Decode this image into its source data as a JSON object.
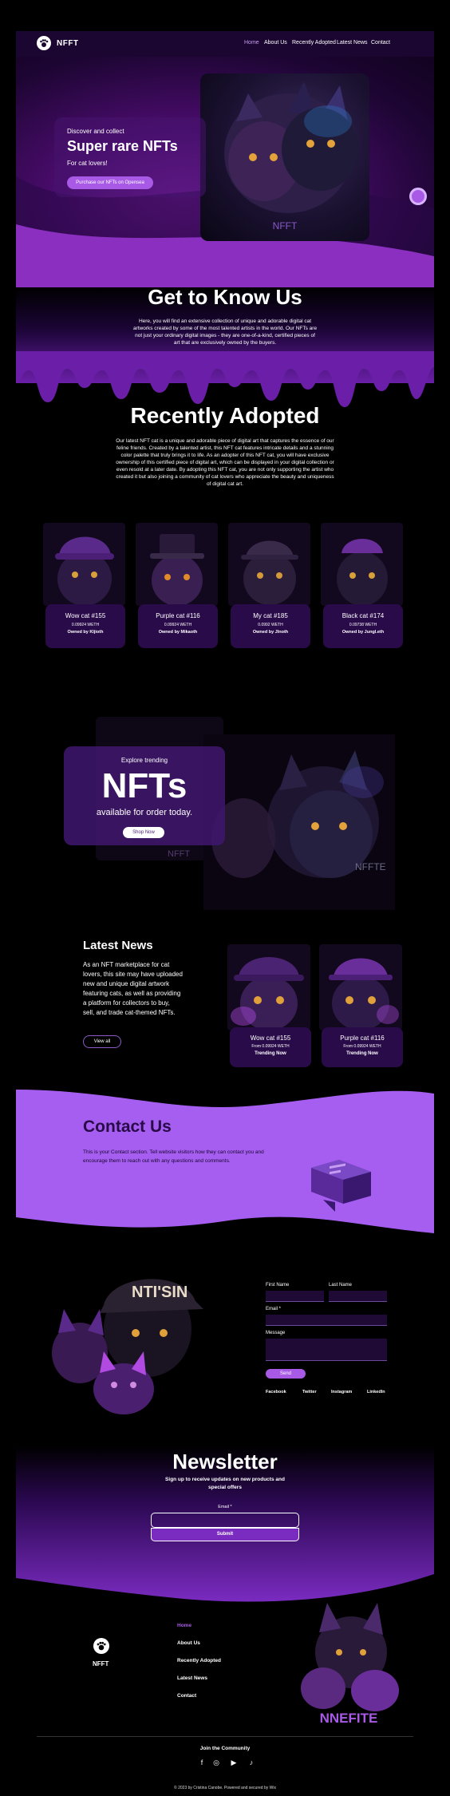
{
  "header": {
    "logo_text": "NFFT",
    "nav": [
      "Home",
      "About Us",
      "Recently Adopted",
      "Latest News",
      "Contact"
    ]
  },
  "hero": {
    "subtitle": "Discover and collect",
    "title": "Super rare NFTs",
    "small": "For cat lovers!",
    "button": "Purchase our NFTs on Opensea",
    "image_watermark": "NFFT"
  },
  "about": {
    "title": "Get to Know Us",
    "text": "Here, you will find an extensive collection of unique and adorable digital cat artworks created by some of the most talented artists in the world. Our NFTs are not just your ordinary digital images - they are one-of-a-kind, certified pieces of art that are exclusively owned by the buyers."
  },
  "recently_adopted": {
    "title": "Recently Adopted",
    "text": "Our latest NFT cat is a unique and adorable piece of digital art that captures the essence of our feline friends. Created by a talented artist, this NFT cat features intricate details and a stunning color palette that truly brings it to life. As an adopter of this NFT cat, you will have exclusive ownership of this certified piece of digital art, which can be displayed in your digital collection or even resold at a later date. By adopting this NFT cat, you are not only supporting the artist who created it but also joining a community of cat lovers who appreciate the beauty and uniqueness of digital cat art.",
    "cards": [
      {
        "name": "Wow cat #155",
        "price": "0.09924 WETH",
        "owner": "Owned by Kljioth"
      },
      {
        "name": "Purple cat #116",
        "price": "0.09924 WETH",
        "owner": "Owned by Mikaoth"
      },
      {
        "name": "My cat #185",
        "price": "0.0992 WETH",
        "owner": "Owned by Jlnoth"
      },
      {
        "name": "Black cat #174",
        "price": "0.09738 WETH",
        "owner": "Owned by Jungl.eth"
      }
    ]
  },
  "nft_banner": {
    "explore": "Explore trending",
    "big": "NFTs",
    "available": "available for order today.",
    "button": "Shop Now",
    "watermark_left": "NFFT",
    "watermark_right": "NFFTE"
  },
  "latest_news": {
    "title": "Latest News",
    "text": "As an NFT marketplace for cat lovers, this site may have uploaded new and unique digital artwork featuring cats, as well as providing a platform for collectors to buy, sell, and trade cat-themed NFTs.",
    "button": "View all",
    "cards": [
      {
        "name": "Wow cat #155",
        "price": "From 0.09924 WETH",
        "label": "Trending Now"
      },
      {
        "name": "Purple cat #116",
        "price": "From 0.09924 WETH",
        "label": "Trending Now"
      }
    ]
  },
  "contact": {
    "title": "Contact Us",
    "text": "This is your Contact section. Tell website visitors how they can contact you and encourage them to reach out with any questions and comments.",
    "form": {
      "first_name": "First Name",
      "last_name": "Last Name",
      "email": "Email *",
      "message": "Message",
      "send": "Send"
    },
    "image_text": "NTI'SIN",
    "socials": [
      "Facebook",
      "Twitter",
      "Instagram",
      "LinkedIn"
    ]
  },
  "newsletter": {
    "title": "Newsletter",
    "subtitle": "Sign up to receive updates on new products and special offers",
    "email_label": "Email *",
    "button": "Submit"
  },
  "footer": {
    "logo_text": "NFFT",
    "links": [
      "Home",
      "About Us",
      "Recently Adopted",
      "Latest News",
      "Contact"
    ],
    "image_text": "NNEFITE",
    "join": "Join the Community",
    "social_icons": [
      "facebook-icon",
      "instagram-icon",
      "youtube-icon",
      "tiktok-icon"
    ],
    "copyright": "© 2023 by Cristina Canobe. Powered and secured by Wix"
  },
  "colors": {
    "accent": "#a85ae6",
    "deep_purple": "#2a0b4a",
    "contact_bg": "#a55ef0"
  }
}
